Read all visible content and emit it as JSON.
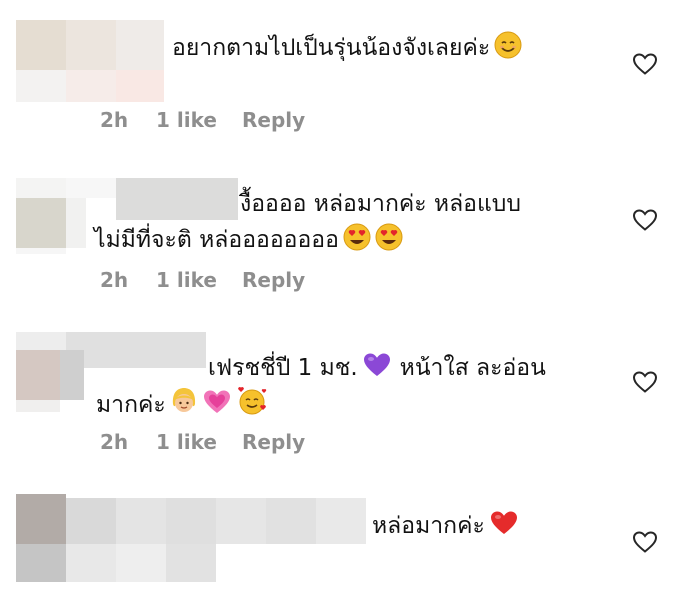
{
  "comments": [
    {
      "text": "อยากตามไปเป็นรุ่นน้องจังเลยค่ะ",
      "emojis": [
        "smiling-face-emoji"
      ],
      "time": "2h",
      "likes": "1 like",
      "reply": "Reply"
    },
    {
      "line1": "งื้ออออ หล่อมากค่ะ หล่อแบบ",
      "line2": "ไม่มีที่จะติ หล่ออออออออ",
      "emojis": [
        "heart-eyes-emoji",
        "heart-eyes-emoji"
      ],
      "time": "2h",
      "likes": "1 like",
      "reply": "Reply"
    },
    {
      "line1": "เฟรชชี่ปี 1 มช.",
      "line1_after": "หน้าใส ละอ่อน",
      "line2": "มากค่ะ",
      "emojis": [
        "purple-heart-emoji",
        "person-emoji",
        "growing-heart-emoji",
        "smiling-face-with-hearts-emoji"
      ],
      "time": "2h",
      "likes": "1 like",
      "reply": "Reply"
    },
    {
      "text": "หล่อมากค่ะ",
      "emojis": [
        "red-heart-emoji"
      ]
    }
  ],
  "colors": {
    "meta_text": "#8e8e8e",
    "body_text": "#121212",
    "heart_icon": "#262626"
  }
}
